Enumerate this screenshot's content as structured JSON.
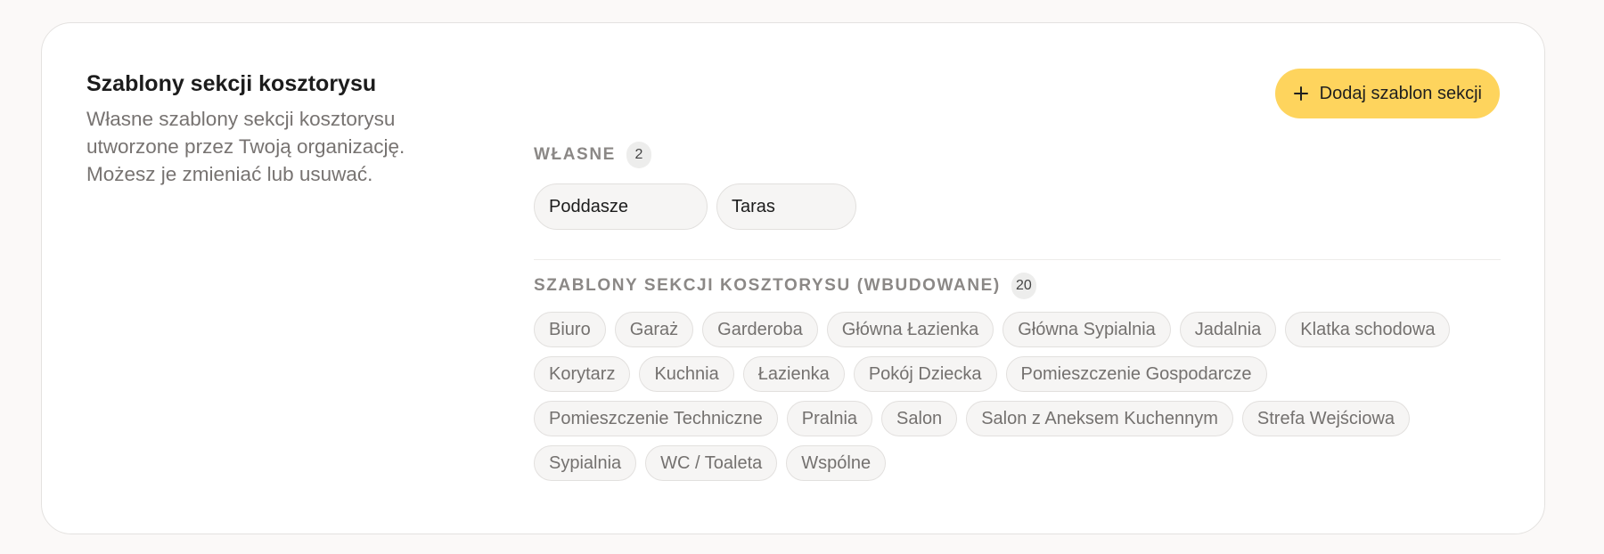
{
  "header": {
    "title": "Szablony sekcji kosztorysu",
    "description": "Własne szablony sekcji kosztorysu utworzone przez Twoją organizację. Możesz je zmieniać lub usuwać."
  },
  "add_button": {
    "label": "Dodaj szablon sekcji",
    "icon": "plus-icon"
  },
  "colors": {
    "accent": "#fed45d",
    "text_primary": "#1c1c1c",
    "text_secondary": "#777371"
  },
  "own_section": {
    "label": "WŁASNE",
    "count": "2",
    "items": [
      "Poddasze",
      "Taras"
    ]
  },
  "builtin_section": {
    "label": "SZABLONY SEKCJI KOSZTORYSU (WBUDOWANE)",
    "count": "20",
    "items": [
      "Biuro",
      "Garaż",
      "Garderoba",
      "Główna Łazienka",
      "Główna Sypialnia",
      "Jadalnia",
      "Klatka schodowa",
      "Korytarz",
      "Kuchnia",
      "Łazienka",
      "Pokój Dziecka",
      "Pomieszczenie Gospodarcze",
      "Pomieszczenie Techniczne",
      "Pralnia",
      "Salon",
      "Salon z Aneksem Kuchennym",
      "Strefa Wejściowa",
      "Sypialnia",
      "WC / Toaleta",
      "Wspólne"
    ]
  }
}
